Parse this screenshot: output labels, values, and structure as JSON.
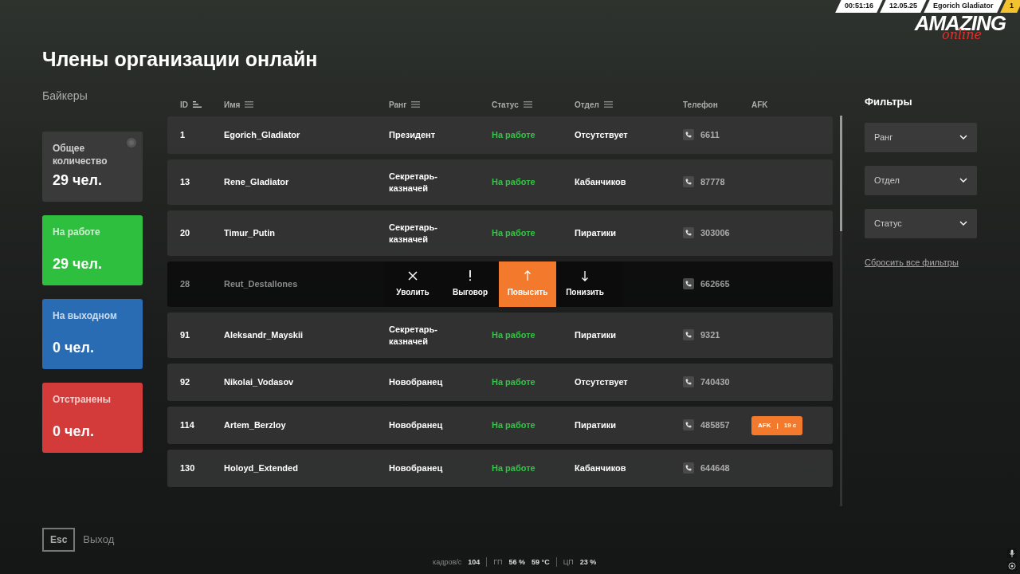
{
  "hud": {
    "time": "00:51:16",
    "date": "12.05.25",
    "player": "Egorich Gladiator",
    "level": "1"
  },
  "logo": {
    "word": "AMAZING",
    "sub": "online"
  },
  "title": "Члены организации онлайн",
  "organization": "Байкеры",
  "stats": [
    {
      "label": "Общее количество",
      "value": "29 чел.",
      "color": "#3a3a3a",
      "dot": true
    },
    {
      "label": "На работе",
      "value": "29 чел.",
      "color": "#2fbf3f",
      "dot": false
    },
    {
      "label": "На выходном",
      "value": "0 чел.",
      "color": "#2a6cb3",
      "dot": false
    },
    {
      "label": "Отстранены",
      "value": "0 чел.",
      "color": "#d33a3a",
      "dot": false
    }
  ],
  "table": {
    "columns": [
      {
        "label": "ID",
        "kind": "sorted"
      },
      {
        "label": "Имя",
        "kind": "sortable"
      },
      {
        "label": "Ранг",
        "kind": "sortable"
      },
      {
        "label": "Статус",
        "kind": "sortable"
      },
      {
        "label": "Отдел",
        "kind": "sortable"
      },
      {
        "label": "Телефон",
        "kind": "plain"
      },
      {
        "label": "AFK",
        "kind": "plain"
      }
    ],
    "rows": [
      {
        "id": "1",
        "name": "Egorich_Gladiator",
        "rank": "Президент",
        "status": "На работе",
        "department": "Отсутствует",
        "phone": "6611",
        "selected": false
      },
      {
        "id": "13",
        "name": "Rene_Gladiator",
        "rank": "Секретарь-казначей",
        "status": "На работе",
        "department": "Кабанчиков",
        "phone": "87778",
        "selected": false
      },
      {
        "id": "20",
        "name": "Timur_Putin",
        "rank": "Секретарь-казначей",
        "status": "На работе",
        "department": "Пиратики",
        "phone": "303006",
        "selected": false
      },
      {
        "id": "28",
        "name": "Reut_Destallones",
        "phone": "662665",
        "selected": true
      },
      {
        "id": "91",
        "name": "Aleksandr_Mayskii",
        "rank": "Секретарь-казначей",
        "status": "На работе",
        "department": "Пиратики",
        "phone": "9321",
        "selected": false
      },
      {
        "id": "92",
        "name": "Nikolai_Vodasov",
        "rank": "Новобранец",
        "status": "На работе",
        "department": "Отсутствует",
        "phone": "740430",
        "selected": false
      },
      {
        "id": "114",
        "name": "Artem_Berzloy",
        "rank": "Новобранец",
        "status": "На работе",
        "department": "Пиратики",
        "phone": "485857",
        "afk": {
          "label": "AFK",
          "separator": "|",
          "time": "19 с"
        },
        "selected": false
      },
      {
        "id": "130",
        "name": "Holoyd_Extended",
        "rank": "Новобранец",
        "status": "На работе",
        "department": "Кабанчиков",
        "phone": "644648",
        "selected": false
      }
    ]
  },
  "actions": [
    {
      "label": "Уволить",
      "kind": "fire",
      "selected": false
    },
    {
      "label": "Выговор",
      "kind": "warn",
      "selected": false
    },
    {
      "label": "Повысить",
      "kind": "up",
      "selected": true
    },
    {
      "label": "Понизить",
      "kind": "down",
      "selected": false
    }
  ],
  "filters": {
    "title": "Фильтры",
    "dropdowns": [
      {
        "placeholder": "Ранг"
      },
      {
        "placeholder": "Отдел"
      },
      {
        "placeholder": "Статус"
      }
    ],
    "reset": "Сбросить все фильтры"
  },
  "exit": {
    "key": "Esc",
    "label": "Выход"
  },
  "perf": [
    {
      "label": "кадров/с",
      "values": [
        "104"
      ]
    },
    {
      "label": "ГП",
      "values": [
        "56 %",
        "59 °C"
      ]
    },
    {
      "label": "ЦП",
      "values": [
        "23 %"
      ]
    }
  ]
}
